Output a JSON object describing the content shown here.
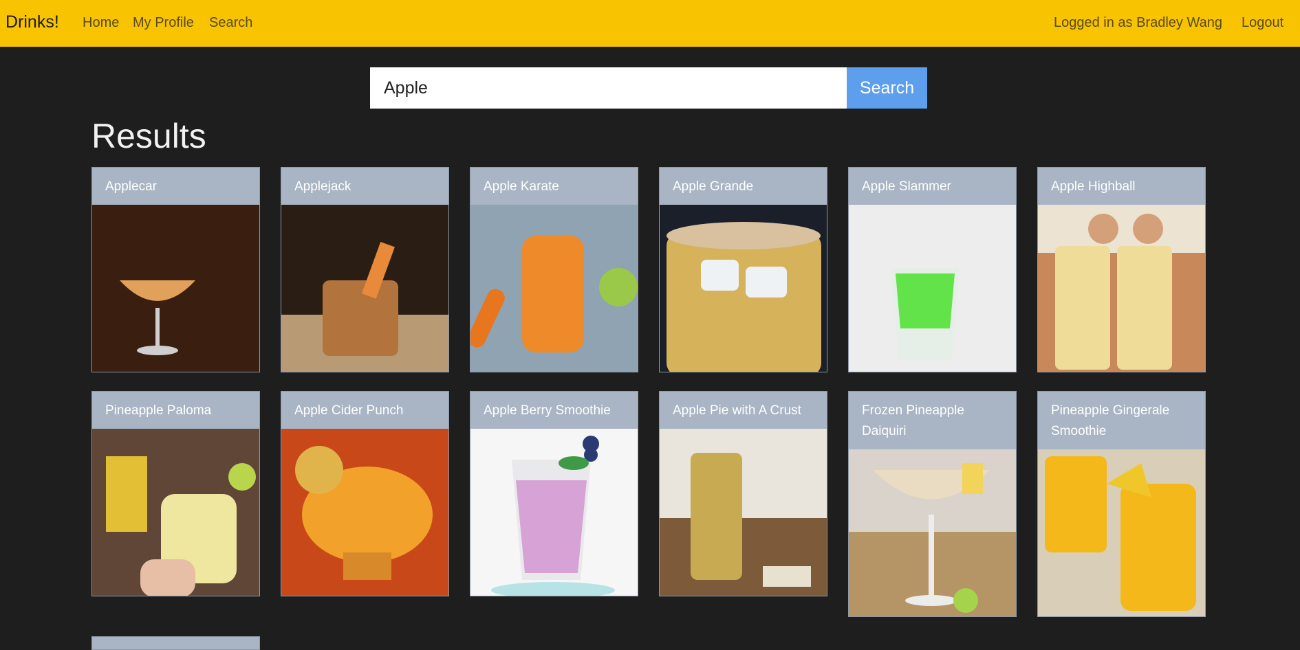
{
  "nav": {
    "brand": "Drinks!",
    "home": "Home",
    "profile": "My Profile",
    "search": "Search",
    "user": "Logged in as Bradley Wang",
    "logout": "Logout"
  },
  "search": {
    "value": "Apple",
    "button": "Search"
  },
  "results": {
    "title": "Results",
    "cards": [
      {
        "title": "Applecar",
        "bg": "#3a1f10",
        "liquid": "#e2a15a"
      },
      {
        "title": "Applejack",
        "bg": "#2a1e14",
        "liquid": "#b3733d"
      },
      {
        "title": "Apple Karate",
        "bg": "#8fa3b3",
        "liquid": "#ef8a2a"
      },
      {
        "title": "Apple Grande",
        "bg": "#1b1f29",
        "liquid": "#d6b25a"
      },
      {
        "title": "Apple Slammer",
        "bg": "#ededed",
        "liquid": "#62e34a"
      },
      {
        "title": "Apple Highball",
        "bg": "#c8885a",
        "liquid": "#eedc98"
      },
      {
        "title": "Pineapple Paloma",
        "bg": "#5f4636",
        "liquid": "#efe6a0"
      },
      {
        "title": "Apple Cider Punch",
        "bg": "#c8481a",
        "liquid": "#f2a12a"
      },
      {
        "title": "Apple Berry Smoothie",
        "bg": "#f6f6f6",
        "liquid": "#d7a3d6"
      },
      {
        "title": "Apple Pie with A Crust",
        "bg": "#e9e4dc",
        "liquid": "#c8aa52"
      },
      {
        "title": "Frozen Pineapple Daiquiri",
        "bg": "#b59466",
        "liquid": "#e9dcc2"
      },
      {
        "title": "Pineapple Gingerale Smoothie",
        "bg": "#d9cfb8",
        "liquid": "#f5b81a"
      }
    ]
  }
}
